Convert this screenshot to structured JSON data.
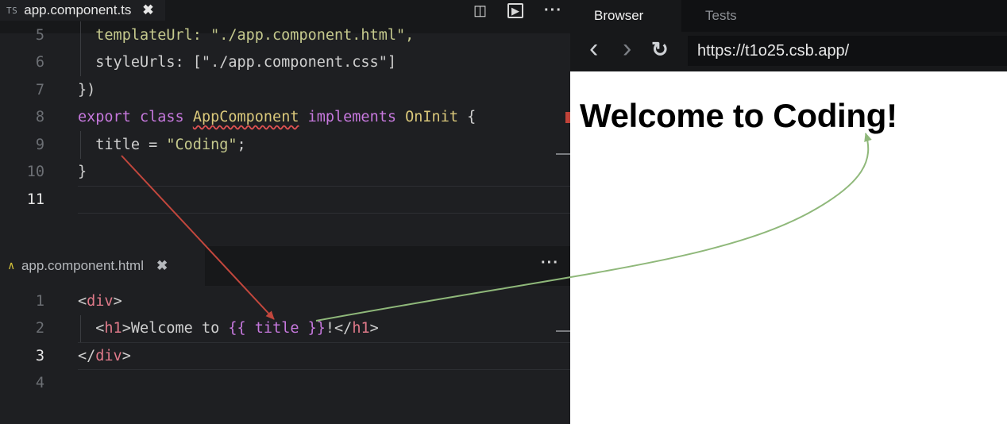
{
  "editor": {
    "top_tab": {
      "icon": "TS",
      "name": "app.component.ts",
      "close": "✖"
    },
    "top_actions": {
      "split": "◫",
      "preview": "▶",
      "more": "···"
    },
    "top_lines": [
      {
        "n": "5",
        "text": "  templateUrl: \"./app.component.html\","
      },
      {
        "n": "6",
        "text": "  styleUrls: [\"./app.component.css\"]"
      },
      {
        "n": "7",
        "text": "})"
      },
      {
        "n": "8",
        "text": "export class AppComponent implements OnInit {"
      },
      {
        "n": "9",
        "text": "  title = \"Coding\";"
      },
      {
        "n": "10",
        "text": "}"
      },
      {
        "n": "11",
        "text": ""
      }
    ],
    "bottom_tab": {
      "icon": "∧",
      "name": "app.component.html",
      "close": "✖"
    },
    "bottom_actions": {
      "more": "···"
    },
    "bottom_lines": [
      {
        "n": "1",
        "text": "<div>"
      },
      {
        "n": "2",
        "text": "  <h1>Welcome to {{ title }}!</h1>"
      },
      {
        "n": "3",
        "text": "</div>"
      },
      {
        "n": "4",
        "text": ""
      }
    ]
  },
  "browser": {
    "tabs": [
      {
        "label": "Browser",
        "active": true
      },
      {
        "label": "Tests",
        "active": false
      }
    ],
    "nav": {
      "back": "‹",
      "forward": "›",
      "reload": "↻"
    },
    "url": "https://t1o25.csb.app/",
    "page_heading": "Welcome to Coding!"
  },
  "colors": {
    "arrow_red": "#c2473d",
    "arrow_green": "#8fb87a"
  }
}
